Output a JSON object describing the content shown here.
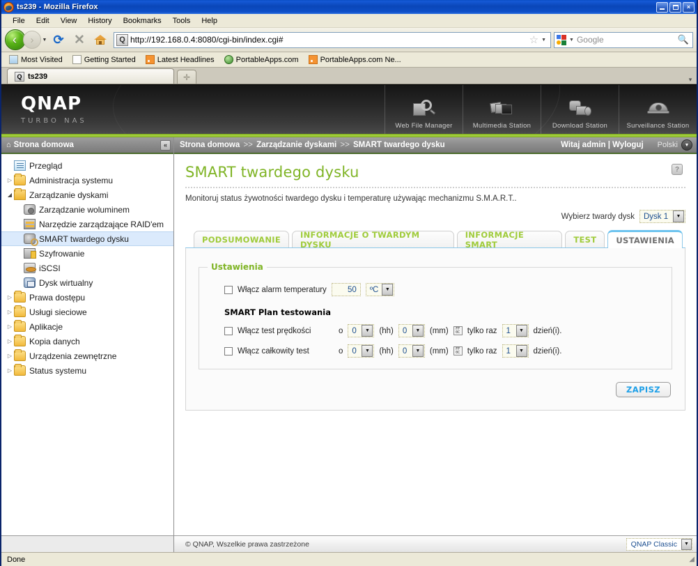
{
  "browser": {
    "window_title": "ts239 - Mozilla Firefox",
    "window_buttons": {
      "minimize": "minimize-icon",
      "maximize": "maximize-icon",
      "close": "×"
    },
    "menu": [
      "File",
      "Edit",
      "View",
      "History",
      "Bookmarks",
      "Tools",
      "Help"
    ],
    "url": "http://192.168.0.4:8080/cgi-bin/index.cgi#",
    "search_placeholder": "Google",
    "bookmarks": [
      {
        "label": "Most Visited",
        "icon": "doc-icon"
      },
      {
        "label": "Getting Started",
        "icon": "page-icon"
      },
      {
        "label": "Latest Headlines",
        "icon": "rss-icon"
      },
      {
        "label": "PortableApps.com",
        "icon": "globe-icon"
      },
      {
        "label": "PortableApps.com Ne...",
        "icon": "rss-icon"
      }
    ],
    "tab_title": "ts239",
    "new_tab_label": "+",
    "status": "Done"
  },
  "qnap": {
    "logo": "QNAP",
    "logo_sub": "TURBO NAS",
    "apps": [
      {
        "label": "Web File Manager",
        "icon": "web-file-manager-icon"
      },
      {
        "label": "Multimedia Station",
        "icon": "multimedia-station-icon"
      },
      {
        "label": "Download Station",
        "icon": "download-station-icon"
      },
      {
        "label": "Surveillance Station",
        "icon": "surveillance-station-icon"
      }
    ],
    "sidebar": {
      "header": "Strona domowa",
      "collapse": "«",
      "items": [
        {
          "label": "Przegląd",
          "icon": "overview-icon",
          "indent": 0,
          "arrow": "",
          "selected": false
        },
        {
          "label": "Administracja systemu",
          "icon": "folder",
          "indent": 0,
          "arrow": "▷",
          "selected": false
        },
        {
          "label": "Zarządzanie dyskami",
          "icon": "folderopen",
          "indent": 0,
          "arrow": "◢",
          "selected": false
        },
        {
          "label": "Zarządzanie woluminem",
          "icon": "disk",
          "indent": 1,
          "arrow": "",
          "selected": false
        },
        {
          "label": "Narzędzie zarządzające RAID'em",
          "icon": "raid",
          "indent": 1,
          "arrow": "",
          "selected": false
        },
        {
          "label": "SMART twardego dysku",
          "icon": "smart",
          "indent": 1,
          "arrow": "",
          "selected": true
        },
        {
          "label": "Szyfrowanie",
          "icon": "lock",
          "indent": 1,
          "arrow": "",
          "selected": false
        },
        {
          "label": "iSCSI",
          "icon": "iscsi",
          "indent": 1,
          "arrow": "",
          "selected": false
        },
        {
          "label": "Dysk wirtualny",
          "icon": "vdisk",
          "indent": 1,
          "arrow": "",
          "selected": false
        },
        {
          "label": "Prawa dostępu",
          "icon": "folder",
          "indent": 0,
          "arrow": "▷",
          "selected": false
        },
        {
          "label": "Usługi sieciowe",
          "icon": "folder",
          "indent": 0,
          "arrow": "▷",
          "selected": false
        },
        {
          "label": "Aplikacje",
          "icon": "folder",
          "indent": 0,
          "arrow": "▷",
          "selected": false
        },
        {
          "label": "Kopia danych",
          "icon": "folder",
          "indent": 0,
          "arrow": "▷",
          "selected": false
        },
        {
          "label": "Urządzenia zewnętrzne",
          "icon": "folder",
          "indent": 0,
          "arrow": "▷",
          "selected": false
        },
        {
          "label": "Status systemu",
          "icon": "folder",
          "indent": 0,
          "arrow": "▷",
          "selected": false
        }
      ]
    },
    "breadcrumb": {
      "part1": "Strona domowa",
      "sep": ">>",
      "part2": "Zarządzanie dyskami",
      "part3": "SMART twardego dysku",
      "welcome": "Witaj admin | Wyloguj",
      "language": "Polski"
    },
    "page": {
      "title": "SMART twardego dysku",
      "help_label": "?",
      "description": "Monitoruj status żywotności twardego dysku i temperaturę używając mechanizmu S.M.A.R.T..",
      "disk_select_label": "Wybierz twardy dysk",
      "disk_select_value": "Dysk 1"
    },
    "tabs": [
      {
        "label": "PODSUMOWANIE",
        "active": false
      },
      {
        "label": "INFORMACJE O TWARDYM DYSKU",
        "active": false
      },
      {
        "label": "INFORMACJE SMART",
        "active": false
      },
      {
        "label": "TEST",
        "active": false
      },
      {
        "label": "USTAWIENIA",
        "active": true
      }
    ],
    "settings": {
      "legend": "Ustawienia",
      "temp_alarm_label": "Włącz alarm temperatury",
      "temp_alarm_checked": false,
      "temp_value": "50",
      "temp_unit": "ºC",
      "schedule_title": "SMART Plan testowania",
      "rows": [
        {
          "label": "Włącz test prędkości",
          "checked": false,
          "at": "o",
          "hours": "0",
          "hh": "(hh)",
          "minutes": "0",
          "mm": "(mm)",
          "icon": "broken-image-icon",
          "only_once": "tylko raz",
          "days": "1",
          "days_suffix": "dzień(i)."
        },
        {
          "label": "Włącz całkowity test",
          "checked": false,
          "at": "o",
          "hours": "0",
          "hh": "(hh)",
          "minutes": "0",
          "mm": "(mm)",
          "icon": "broken-image-icon",
          "only_once": "tylko raz",
          "days": "1",
          "days_suffix": "dzień(i)."
        }
      ],
      "save_label": "ZAPISZ"
    },
    "footer": {
      "copyright": "© QNAP, Wszelkie prawa zastrzeżone",
      "theme": "QNAP Classic"
    },
    "colors": {
      "green": "#9fcb3a",
      "title_green": "#7fb425",
      "accent_blue": "#1ea0e8",
      "tab_active_top": "#6cc3ef",
      "field_value": "#1a4d8f"
    }
  }
}
